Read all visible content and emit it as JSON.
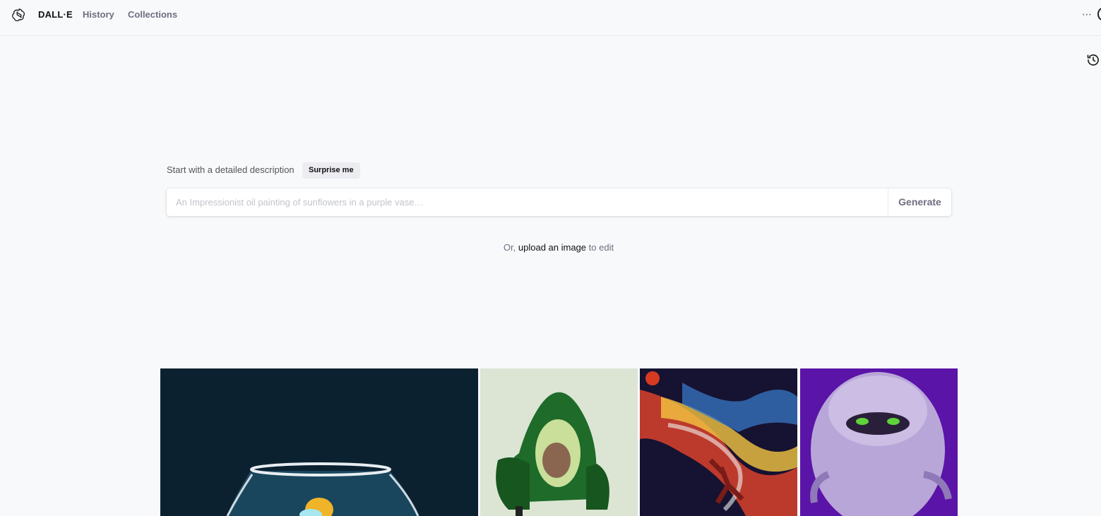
{
  "header": {
    "brand": "DALL·E",
    "nav": [
      "History",
      "Collections"
    ],
    "logo_icon": "openai-logo-icon",
    "more_icon": "more-dots-icon"
  },
  "side": {
    "history_icon": "history-clock-icon"
  },
  "prompt": {
    "label": "Start with a detailed description",
    "surprise_label": "Surprise me",
    "placeholder": "An Impressionist oil painting of sunflowers in a purple vase…",
    "value": "",
    "generate_label": "Generate"
  },
  "upload": {
    "prefix": "Or,",
    "link": "upload an image",
    "suffix": "to edit"
  },
  "gallery": [
    {
      "subject": "fishbowl on dark teal background"
    },
    {
      "subject": "avocado-shaped green armchair"
    },
    {
      "subject": "colorful space painting of basketball player"
    },
    {
      "subject": "fluffy purple furry monster"
    }
  ],
  "colors": {
    "background": "#f8f9fb",
    "muted_text": "#6e6e80",
    "surprise_bg": "#ececf1"
  }
}
